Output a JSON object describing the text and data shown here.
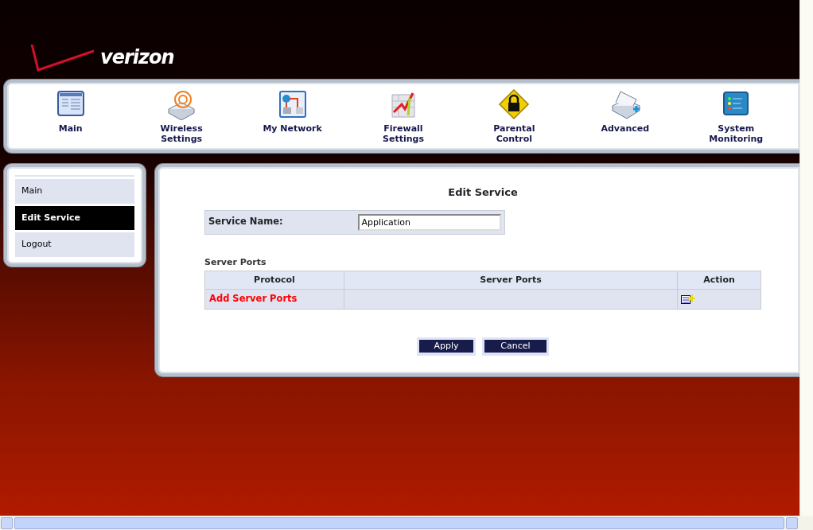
{
  "logo": {
    "text": "verizon"
  },
  "nav": [
    {
      "label": "Main"
    },
    {
      "label": "Wireless Settings"
    },
    {
      "label": "My Network"
    },
    {
      "label": "Firewall Settings"
    },
    {
      "label": "Parental Control"
    },
    {
      "label": "Advanced"
    },
    {
      "label": "System Monitoring"
    }
  ],
  "sidebar": {
    "items": [
      {
        "label": "Main",
        "selected": false
      },
      {
        "label": "Edit Service",
        "selected": true
      },
      {
        "label": "Logout",
        "selected": false
      }
    ]
  },
  "page_title": "Edit Service",
  "service_name": {
    "label": "Service Name:",
    "value": "Application"
  },
  "section_title": "Server Ports",
  "table": {
    "columns": [
      "Protocol",
      "Server Ports",
      "Action"
    ],
    "rows": [
      {
        "link": "Add Server Ports"
      }
    ]
  },
  "buttons": [
    "Apply",
    "Cancel"
  ]
}
